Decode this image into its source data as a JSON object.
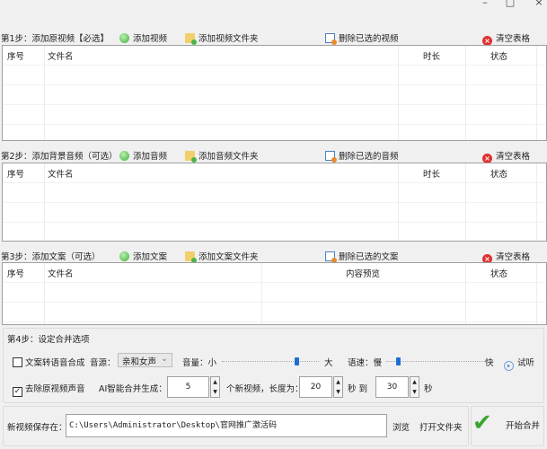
{
  "window": {
    "minimize": "–",
    "maximize": "□",
    "close": "×"
  },
  "step1": {
    "label": "第1步：添加原视频【必选】",
    "add": "添加视频",
    "add_folder": "添加视频文件夹",
    "delete": "删除已选的视频",
    "clear": "清空表格",
    "columns": [
      "序号",
      "文件名",
      "时长",
      "状态"
    ]
  },
  "step2": {
    "label": "第2步：添加背景音频（可选）",
    "add": "添加音频",
    "add_folder": "添加音频文件夹",
    "delete": "删除已选的音频",
    "clear": "清空表格",
    "columns": [
      "序号",
      "文件名",
      "时长",
      "状态"
    ]
  },
  "step3": {
    "label": "第3步：添加文案（可选）",
    "add": "添加文案",
    "add_folder": "添加文案文件夹",
    "delete": "删除已选的文案",
    "clear": "清空表格",
    "columns": [
      "序号",
      "文件名",
      "内容预览",
      "状态"
    ]
  },
  "step4": {
    "label": "第4步：设定合并选项",
    "tts": {
      "label": "文案转语音合成",
      "checked": false
    },
    "voice": {
      "label": "音源：",
      "value": "亲和女声"
    },
    "volume": {
      "label": "音量：小",
      "max_label": "大",
      "level_percent": 75
    },
    "speed": {
      "label": "语速：慢",
      "max_label": "快",
      "level_percent": 10
    },
    "preview": "试听",
    "remove_audio": {
      "label": "去除原视频声音",
      "checked": true
    },
    "generate_label": "AI智能合并生成：",
    "count": "5",
    "count_suffix": "个新视频，长度为：",
    "min_len": "20",
    "to": "秒 到",
    "max_len": "30",
    "sec": "秒"
  },
  "output": {
    "label": "新视频保存在：",
    "path": "C:\\Users\\Administrator\\Desktop\\官网推广激活码",
    "browse": "浏览",
    "open_folder": "打开文件夹",
    "start": "开始合并"
  }
}
